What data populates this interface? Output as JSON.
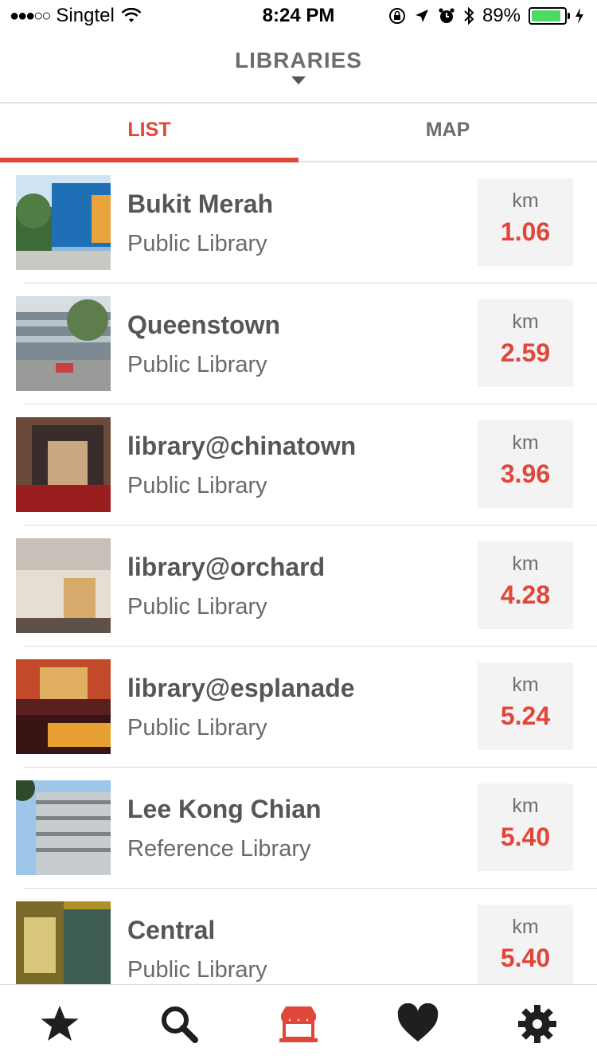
{
  "status": {
    "signal_dots": "●●●○○",
    "carrier": "Singtel",
    "time": "8:24 PM",
    "battery_percent": "89%",
    "battery_level": 0.89
  },
  "header": {
    "title": "LIBRARIES"
  },
  "tabs": [
    {
      "label": "LIST",
      "active": true
    },
    {
      "label": "MAP",
      "active": false
    }
  ],
  "libraries": [
    {
      "name": "Bukit Merah",
      "type": "Public Library",
      "unit": "km",
      "distance": "1.06"
    },
    {
      "name": "Queenstown",
      "type": "Public Library",
      "unit": "km",
      "distance": "2.59"
    },
    {
      "name": "library@chinatown",
      "type": "Public Library",
      "unit": "km",
      "distance": "3.96"
    },
    {
      "name": "library@orchard",
      "type": "Public Library",
      "unit": "km",
      "distance": "4.28"
    },
    {
      "name": "library@esplanade",
      "type": "Public Library",
      "unit": "km",
      "distance": "5.24"
    },
    {
      "name": "Lee Kong Chian",
      "type": "Reference Library",
      "unit": "km",
      "distance": "5.40"
    },
    {
      "name": "Central",
      "type": "Public Library",
      "unit": "km",
      "distance": "5.40"
    }
  ],
  "nav": [
    {
      "icon": "star-icon",
      "active": false
    },
    {
      "icon": "search-icon",
      "active": false
    },
    {
      "icon": "store-icon",
      "active": true
    },
    {
      "icon": "heart-icon",
      "active": false
    },
    {
      "icon": "gear-icon",
      "active": false
    }
  ],
  "colors": {
    "accent": "#e0463a",
    "text": "#565656",
    "tile": "#f3f3f3"
  }
}
